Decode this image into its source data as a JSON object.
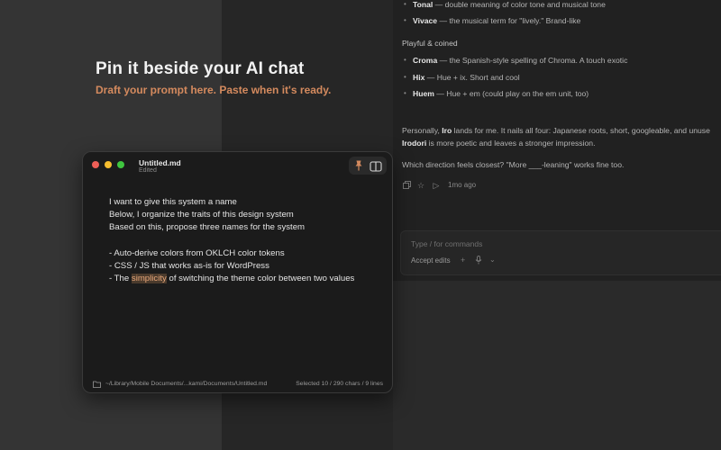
{
  "hero": {
    "title": "Pin it beside your AI chat",
    "subtitle": "Draft your prompt here. Paste when it's ready."
  },
  "chat": {
    "top_items": [
      {
        "name": "Tonal",
        "desc": " — double meaning of color tone and musical tone"
      },
      {
        "name": "Vivace",
        "desc": " — the musical term for \"lively.\" Brand-like"
      }
    ],
    "section_label": "Playful & coined",
    "coined_items": [
      {
        "name": "Croma",
        "desc": " — the Spanish-style spelling of Chroma. A touch exotic"
      },
      {
        "name": "Hix",
        "desc": " — Hue + ix. Short and cool"
      },
      {
        "name": "Huem",
        "desc": " — Hue + em (could play on the em unit, too)"
      }
    ],
    "para1_a": "Personally, ",
    "para1_bold1": "Iro",
    "para1_b": " lands for me. It nails all four: Japanese roots, short, googleable, and unuse",
    "para2_bold": "Irodori",
    "para2_rest": " is more poetic and leaves a stronger impression.",
    "para3": "Which direction feels closest? \"More ___-leaning\" works fine too.",
    "timestamp": "1mo ago",
    "composer_placeholder": "Type / for commands",
    "accept_label": "Accept edits"
  },
  "window": {
    "title": "Untitled.md",
    "subtitle": "Edited",
    "lines": [
      "I want to give this system a name",
      "Below, I organize the traits of this design system",
      "Based on this, propose three names for the system",
      "",
      "- Auto-derive colors from OKLCH color tokens",
      "-  CSS / JS that works as-is for WordPress"
    ],
    "last_line_before": "- The ",
    "last_line_selected": "simplicity",
    "last_line_after": " of switching the theme color between two values",
    "path": "~/Library/Mobile Documents/...kami/Documents/Untitled.md",
    "count": "Selected 10 / 290 chars / 9 lines"
  },
  "colors": {
    "accent": "#d48a5e",
    "traffic_red": "#ee5f57",
    "traffic_yellow": "#f5bd2f",
    "traffic_green": "#3fc53f"
  }
}
